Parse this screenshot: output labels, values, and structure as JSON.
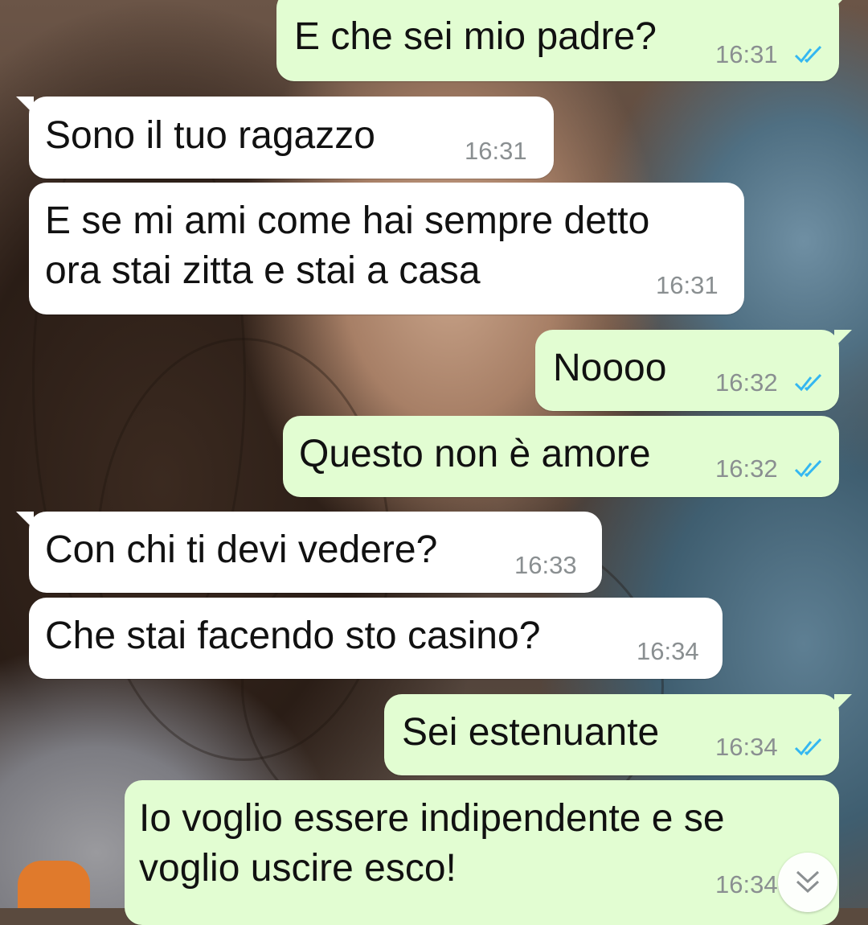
{
  "colors": {
    "incoming_bubble": "#ffffff",
    "outgoing_bubble": "#e2fdd2",
    "read_ticks": "#34b7f1",
    "timestamp": "#8a8f91"
  },
  "messages": [
    {
      "direction": "out",
      "lines": [
        "E che sei mio padre?"
      ],
      "time": "16:31",
      "status": "read"
    },
    {
      "direction": "in",
      "lines": [
        "Sono il tuo ragazzo"
      ],
      "time": "16:31"
    },
    {
      "direction": "in",
      "lines": [
        "E se mi ami come hai sempre detto",
        "ora stai zitta e stai a casa"
      ],
      "time": "16:31"
    },
    {
      "direction": "out",
      "lines": [
        "Noooo"
      ],
      "time": "16:32",
      "status": "read"
    },
    {
      "direction": "out",
      "lines": [
        "Questo non è amore"
      ],
      "time": "16:32",
      "status": "read"
    },
    {
      "direction": "in",
      "lines": [
        "Con chi ti devi vedere?"
      ],
      "time": "16:33"
    },
    {
      "direction": "in",
      "lines": [
        "Che stai facendo sto casino?"
      ],
      "time": "16:34"
    },
    {
      "direction": "out",
      "lines": [
        "Sei estenuante"
      ],
      "time": "16:34",
      "status": "read"
    },
    {
      "direction": "out",
      "lines": [
        "Io voglio essere indipendente e se",
        "voglio uscire esco!"
      ],
      "time": "16:34",
      "status": "read"
    }
  ],
  "icons": {
    "read_receipt": "double-check-icon",
    "scroll_down": "chevron-double-down-icon"
  }
}
